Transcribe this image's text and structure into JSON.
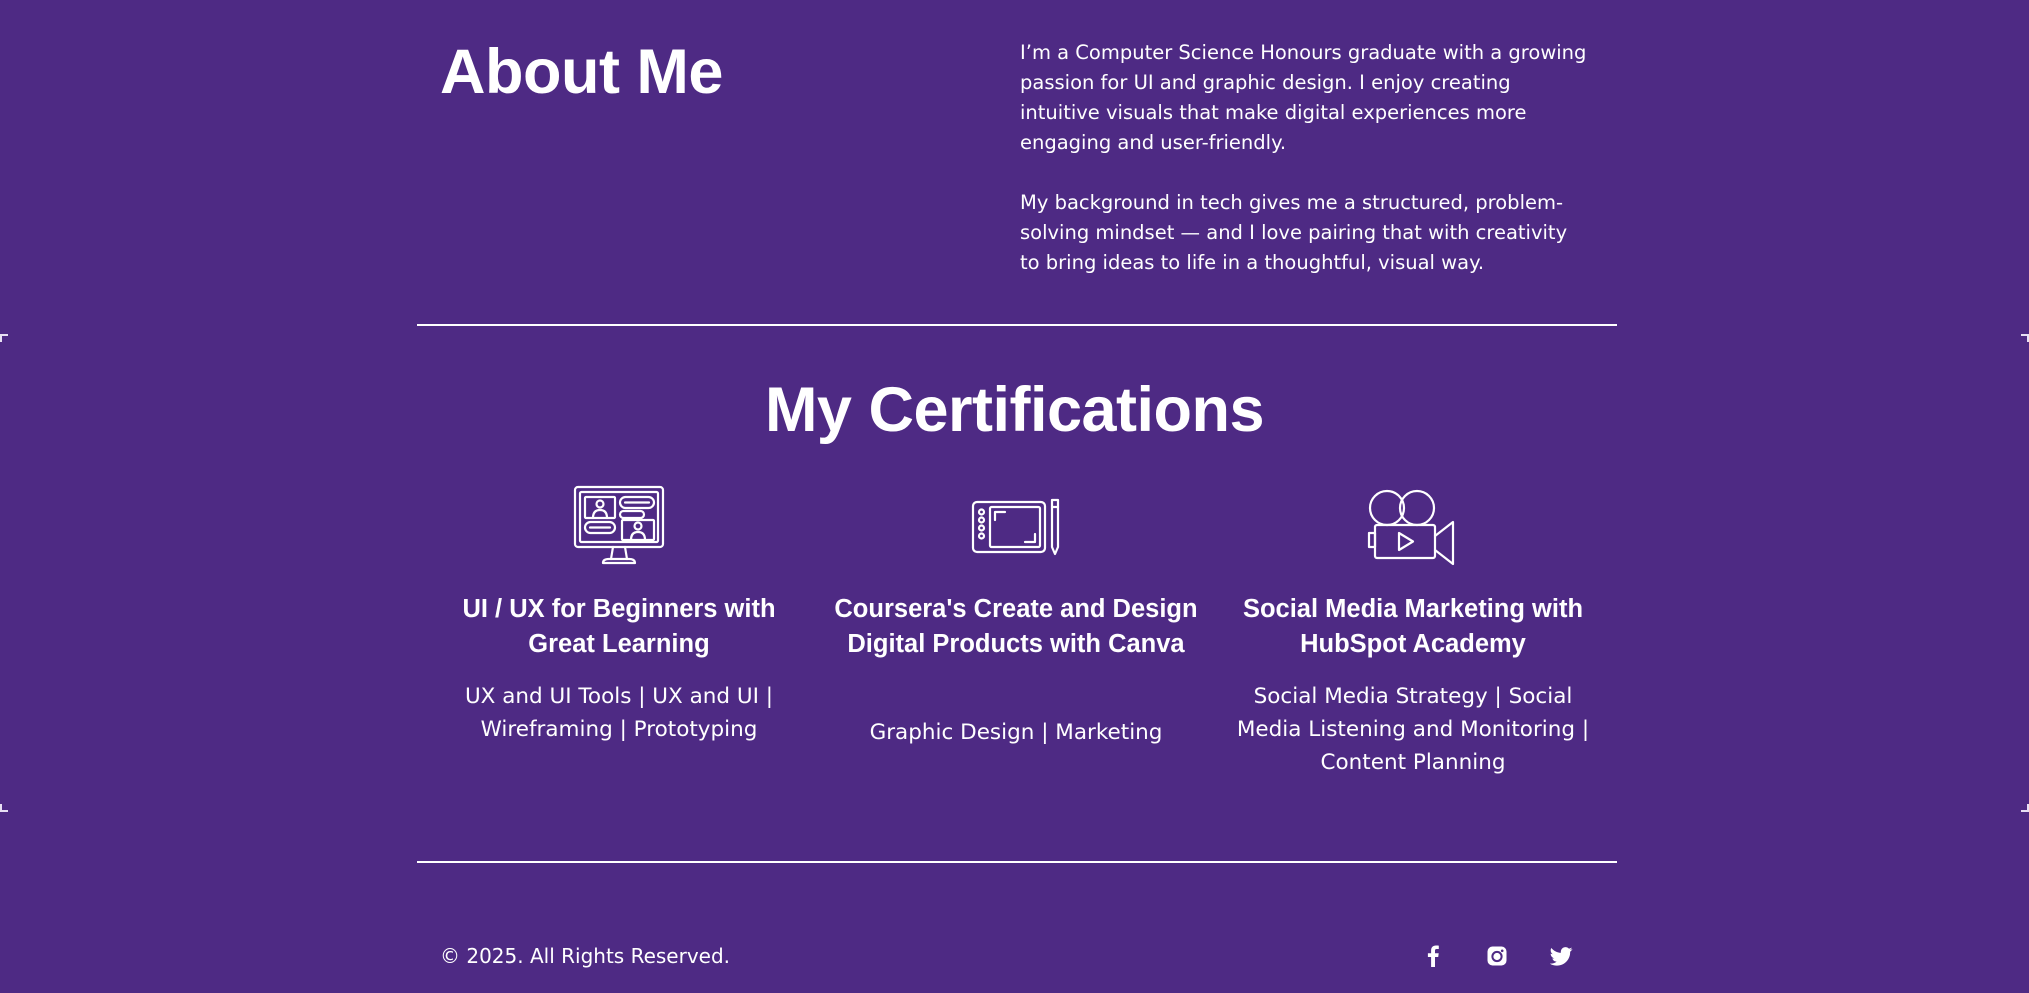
{
  "about": {
    "title": "About Me",
    "paragraph_1": "I’m a Computer Science Honours graduate with a growing passion for UI and graphic design. I enjoy creating intuitive visuals that make digital experiences more engaging and user-friendly.",
    "paragraph_2": "My background in tech gives me a structured, problem-solving mindset — and I love pairing that with creativity to bring ideas to life in a thoughtful, visual way."
  },
  "certifications": {
    "title": "My Certifications",
    "items": [
      {
        "icon": "monitor-video-call-icon",
        "title": "UI / UX for Beginners with Great Learning",
        "skills": "UX and UI Tools | UX and UI | Wireframing | Prototyping"
      },
      {
        "icon": "drawing-tablet-icon",
        "title": "Coursera's Create and Design Digital Products with Canva",
        "skills": "Graphic Design | Marketing"
      },
      {
        "icon": "video-camera-icon",
        "title": "Social Media Marketing with HubSpot Academy",
        "skills": "Social Media Strategy | Social Media Listening and Monitoring | Content Planning"
      }
    ]
  },
  "footer": {
    "copyright": "© 2025. All Rights Reserved.",
    "social": [
      "facebook-icon",
      "instagram-icon",
      "twitter-icon"
    ]
  },
  "colors": {
    "background": "#4e2a84",
    "text": "#ffffff"
  }
}
